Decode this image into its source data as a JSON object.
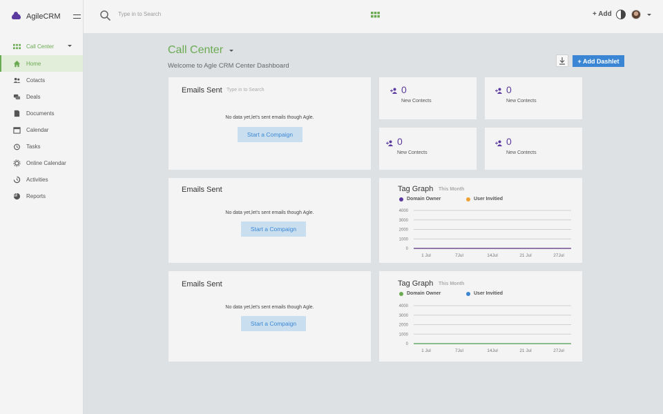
{
  "brand": {
    "name": "AgileCRM"
  },
  "sidebar": {
    "section": "Call Center",
    "items": [
      {
        "label": "Home",
        "icon": "home-icon",
        "active": true
      },
      {
        "label": "Cotacts",
        "icon": "contacts-icon"
      },
      {
        "label": "Deals",
        "icon": "deals-icon"
      },
      {
        "label": "Documents",
        "icon": "documents-icon"
      },
      {
        "label": "Calendar",
        "icon": "calendar-icon"
      },
      {
        "label": "Tasks",
        "icon": "tasks-icon"
      },
      {
        "label": "Online Calendar",
        "icon": "online-calendar-icon"
      },
      {
        "label": "Activities",
        "icon": "activities-icon"
      },
      {
        "label": "Reports",
        "icon": "reports-icon"
      }
    ]
  },
  "topbar": {
    "search_placeholder": "Type in to Search",
    "add_label": "+ Add"
  },
  "main": {
    "title": "Call Center",
    "subtitle": "Welcome to Agle CRM Center Dashboard",
    "add_dashlet_label": "+ Add Dashlet"
  },
  "emails_cards": [
    {
      "title": "Emails Sent",
      "hint": "Type in to Search",
      "message": "No data yet,let's sent emails though Agle.",
      "button": "Start a Compaign"
    },
    {
      "title": "Emails Sent",
      "hint": "",
      "message": "No data yet,let's sent emails though Agle.",
      "button": "Start a Compaign"
    },
    {
      "title": "Emails Sent",
      "hint": "",
      "message": "No data yet,let's sent emails though Agle.",
      "button": "Start a Compaign"
    }
  ],
  "stats": [
    {
      "value": "0",
      "label": "New Contects"
    },
    {
      "value": "0",
      "label": "New Contects"
    },
    {
      "value": "0",
      "label": "New Contects"
    },
    {
      "value": "0",
      "label": "New Contects"
    }
  ],
  "colors": {
    "accent_green": "#6aaa52",
    "accent_purple": "#5a3a9e",
    "accent_blue": "#3a86d4",
    "legend_orange": "#f0a030",
    "legend_green": "#6aaa52"
  },
  "chart_data": [
    {
      "type": "line",
      "title": "Tag Graph",
      "subtitle": "This Month",
      "x": [
        "1 Jul",
        "7Jul",
        "14Jul",
        "21 Jul",
        "27Jul"
      ],
      "yticks": [
        "4000",
        "3000",
        "2000",
        "1000",
        "0"
      ],
      "ylim": [
        0,
        4000
      ],
      "grid": true,
      "legend_position": "top-left",
      "series": [
        {
          "name": "Domain Owner",
          "color": "#5a3a9e",
          "values": [
            0,
            0,
            0,
            0,
            0
          ]
        },
        {
          "name": "User Invitied",
          "color": "#f0a030",
          "values": [
            0,
            0,
            0,
            0,
            0
          ]
        }
      ]
    },
    {
      "type": "line",
      "title": "Tag Graph",
      "subtitle": "This Month",
      "x": [
        "1 Jul",
        "7Jul",
        "14Jul",
        "21 Jul",
        "27Jul"
      ],
      "yticks": [
        "4000",
        "3000",
        "2000",
        "1000",
        "0"
      ],
      "ylim": [
        0,
        4000
      ],
      "grid": true,
      "legend_position": "top-left",
      "series": [
        {
          "name": "Domain Owner",
          "color": "#6aaa52",
          "values": [
            0,
            0,
            0,
            0,
            0
          ]
        },
        {
          "name": "User Invitied",
          "color": "#3a86d4",
          "values": [
            0,
            0,
            0,
            0,
            0
          ]
        }
      ]
    }
  ]
}
